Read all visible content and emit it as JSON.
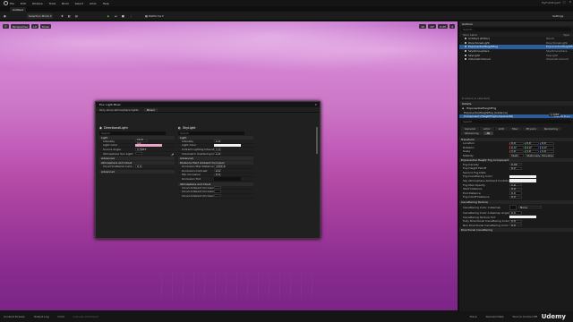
{
  "menu": {
    "items": [
      "File",
      "Edit",
      "Window",
      "Tools",
      "Build",
      "Select",
      "Actor",
      "Help"
    ],
    "project": "MyFirstProject",
    "controls": [
      "–",
      "□",
      "✕"
    ]
  },
  "tab": {
    "label": "Untitled"
  },
  "toolbar": {
    "save": "",
    "mode": "Selection Mode",
    "platforms": "Platforms",
    "settings": "Settings"
  },
  "viewport": {
    "perspective": "Perspective",
    "lit": "Lit",
    "show": "Show",
    "right_vals": [
      "10",
      "10°",
      "0.25",
      "4"
    ]
  },
  "dialog": {
    "title": "Env. Light Mixer",
    "filter_label": "Only show atmosphere lights",
    "filter_value": "Mixed",
    "close": "✕",
    "left": {
      "title": "DirectionalLight",
      "search": "Search",
      "sections": [
        {
          "name": "Light",
          "rows": [
            [
              "Intensity",
              "10.0 lux"
            ],
            [
              "Light Color",
              ""
            ],
            [
              "Source Angle",
              "0.5357"
            ],
            [
              "Atmosphere Sun Light",
              "",
              ""
            ]
          ]
        },
        {
          "name": "Advanced",
          "rows": []
        },
        {
          "name": "Atmosphere and Cloud",
          "rows": [
            [
              "Cloud Scattered Lumi...",
              "0.0"
            ]
          ]
        },
        {
          "name": "Advanced",
          "rows": []
        }
      ]
    },
    "right": {
      "title": "SkyLight",
      "search": "Search",
      "sections": [
        {
          "name": "Light",
          "rows": [
            [
              "Intensity",
              "1.0"
            ],
            [
              "Light Color",
              ""
            ],
            [
              "Indirect Lighting Intensity",
              "1.0"
            ],
            [
              "Volumetric Scattering In...",
              "1.0"
            ]
          ]
        },
        {
          "name": "Advanced",
          "rows": []
        },
        {
          "name": "Distance Field Ambient Occlusion",
          "rows": [
            [
              "Occlusion Max Distance",
              "1000.0"
            ],
            [
              "Occlusion Contrast",
              "0.0"
            ],
            [
              "Min Occlusion",
              "0.0"
            ],
            [
              "Occlusion Tint",
              ""
            ]
          ]
        },
        {
          "name": "Atmosphere and Cloud",
          "rows": [
            [
              "Cloud Ambient Occlusion",
              ""
            ],
            [
              "Cloud Ambient Occlusion...",
              ""
            ],
            [
              "Cloud Ambient Occlusion...",
              ""
            ]
          ]
        }
      ]
    }
  },
  "outliner": {
    "title": "Outliner",
    "search": "Search...",
    "col_label": "Item Label",
    "col_type": "Type",
    "items": [
      {
        "name": "Untitled (Editor)",
        "type": "World",
        "sel": false
      },
      {
        "name": "DirectionalLight",
        "type": "DirectionalLight",
        "sel": false
      },
      {
        "name": "ExponentialHeightFog",
        "type": "ExponentialHeightFog",
        "sel": true
      },
      {
        "name": "SkyAtmosphere",
        "type": "SkyAtmosphere",
        "sel": false
      },
      {
        "name": "SkyLight",
        "type": "SkyLight",
        "sel": false
      },
      {
        "name": "VolumetricCloud",
        "type": "VolumetricCloud",
        "sel": false
      }
    ],
    "footer": "6 actors (1 selected)"
  },
  "details": {
    "title": "Details",
    "actor": "ExponentialHeightFog",
    "add": "+ Add",
    "component_root": "ExponentialHeightFog (Instance)",
    "component_child": "Component (HeightFogComponent0)",
    "edit_cpp": "Edit in C++",
    "search": "Search",
    "tabs": [
      "General",
      "Actor",
      "LOD",
      "Misc",
      "Physics",
      "Rendering",
      "Streaming",
      "All"
    ],
    "transform": {
      "title": "Transform",
      "location": [
        "0.0",
        "0.0",
        "0.0"
      ],
      "rotation": [
        "0.0°",
        "0.0°",
        "0.0°"
      ],
      "scale": [
        "1.0",
        "1.0",
        "1.0"
      ],
      "mobility": [
        "Static",
        "Stationary",
        "Movable"
      ]
    },
    "fog": {
      "title": "Exponential Height Fog Component",
      "rows": [
        [
          "Fog Density",
          "0.02"
        ],
        [
          "Fog Height Falloff",
          "0.2"
        ],
        [
          "Second Fog Data",
          ""
        ],
        [
          "Fog Inscattering Color",
          ""
        ],
        [
          "Sky Atmosphere Ambient Contribution...",
          ""
        ],
        [
          "Fog Max Opacity",
          "1.0"
        ],
        [
          "Start Distance",
          "0.0"
        ],
        [
          "End Distance",
          "0.0"
        ],
        [
          "Fog Cutoff Distance",
          "0.0"
        ]
      ]
    },
    "inscatter": {
      "title": "Inscattering Texture",
      "rows": [
        [
          "Inscattering Color Cubemap",
          "None"
        ],
        [
          "Inscattering Color Cubemap Angle",
          "0.0"
        ],
        [
          "Inscattering Texture Tint",
          ""
        ],
        [
          "Fully Directional Inscattering Color Dist...",
          "0.0"
        ],
        [
          "Non Directional Inscattering Color Dist...",
          "0.0"
        ]
      ]
    },
    "directional": "Directional Inscattering"
  },
  "status": {
    "items": [
      "Content Drawer",
      "Output Log",
      "Cmd",
      "Console Command",
      "Trace",
      "Derived Data",
      "Source Control Off"
    ],
    "watermark": "Udemy"
  }
}
